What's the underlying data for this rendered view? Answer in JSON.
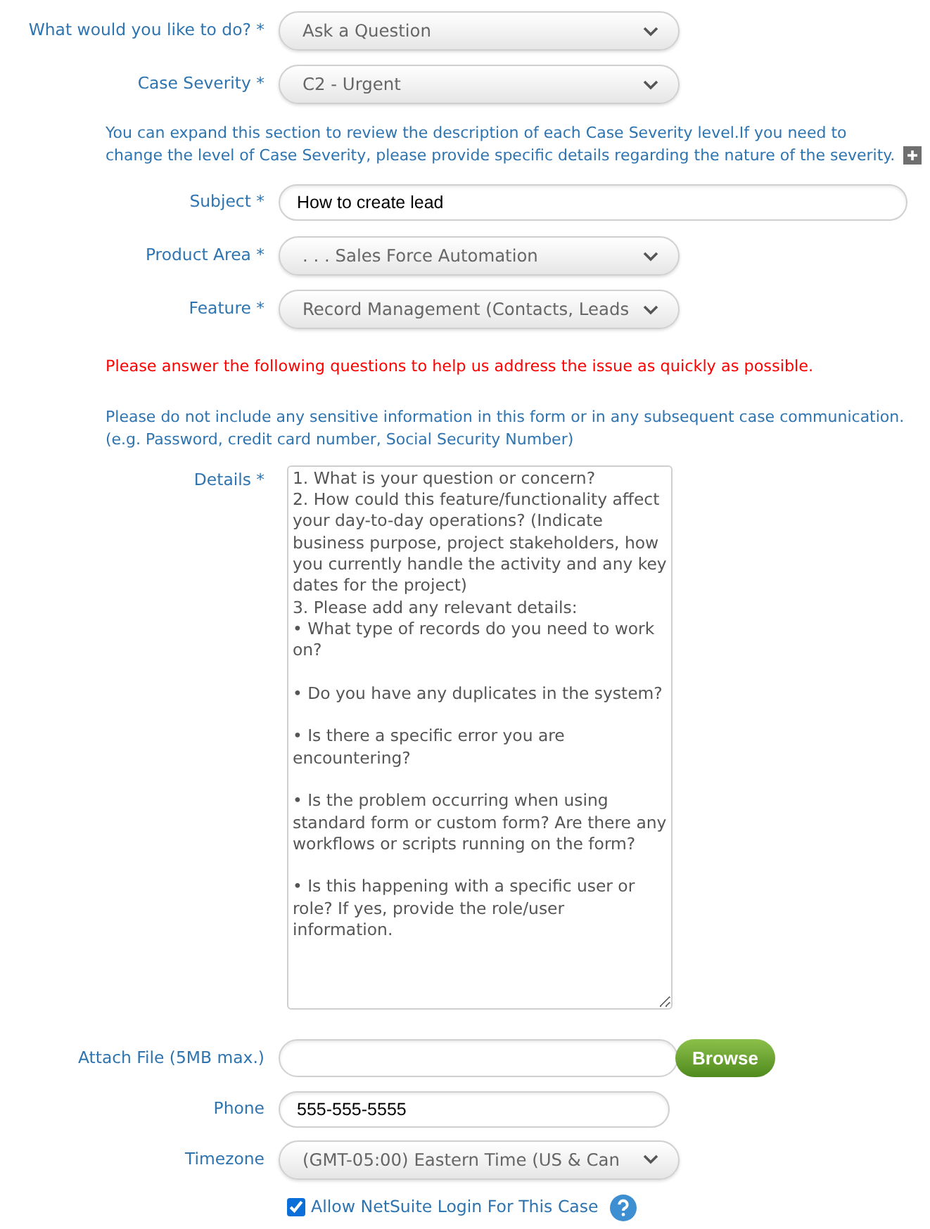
{
  "fields_top": [
    {
      "kind": "select",
      "label": "What would you like to do? *",
      "value": "Ask a Question"
    },
    {
      "kind": "select",
      "label": "Case Severity *",
      "value": "C2 - Urgent"
    }
  ],
  "severity_note": "You can expand this section to review the description of each Case Severity level.If you need to change the level of Case Severity, please provide specific details regarding the nature of the severity.",
  "fields_mid": [
    {
      "kind": "text",
      "label": "Subject *",
      "value": "How to create lead"
    },
    {
      "kind": "select",
      "label": "Product Area *",
      "value": ". . . Sales Force Automation"
    },
    {
      "kind": "select",
      "label": "Feature *",
      "value": "Record Management (Contacts, Leads"
    }
  ],
  "warning": "Please answer the following questions to help us address the issue as quickly as possible.",
  "privacy_note": "Please do not include any sensitive information in this form or in any subsequent case communication. (e.g. Password, credit card number, Social Security Number)",
  "details": {
    "label": "Details *",
    "value": "1. What is your question or concern?\n2. How could this feature/functionality affect your day-to-day operations? (Indicate business purpose, project stakeholders, how you currently handle the activity and any key dates for the project)\n3. Please add any relevant details:\n• What type of records do you need to work on?\n\n• Do you have any duplicates in the system?\n\n• Is there a specific error you are encountering?\n\n• Is the problem occurring when using standard form or custom form? Are there any workflows or scripts running on the form?\n\n• Is this happening with a specific user or role? If yes, provide the role/user information."
  },
  "fields_bottom": [
    {
      "kind": "file",
      "label": "Attach File (5MB max.)",
      "button": "Browse"
    },
    {
      "kind": "phone",
      "label": "Phone",
      "value": "555-555-5555"
    },
    {
      "kind": "select",
      "label": "Timezone",
      "value": "(GMT-05:00) Eastern Time (US & Can"
    }
  ],
  "login": {
    "label": "Allow NetSuite Login For This Case",
    "checked": true
  }
}
